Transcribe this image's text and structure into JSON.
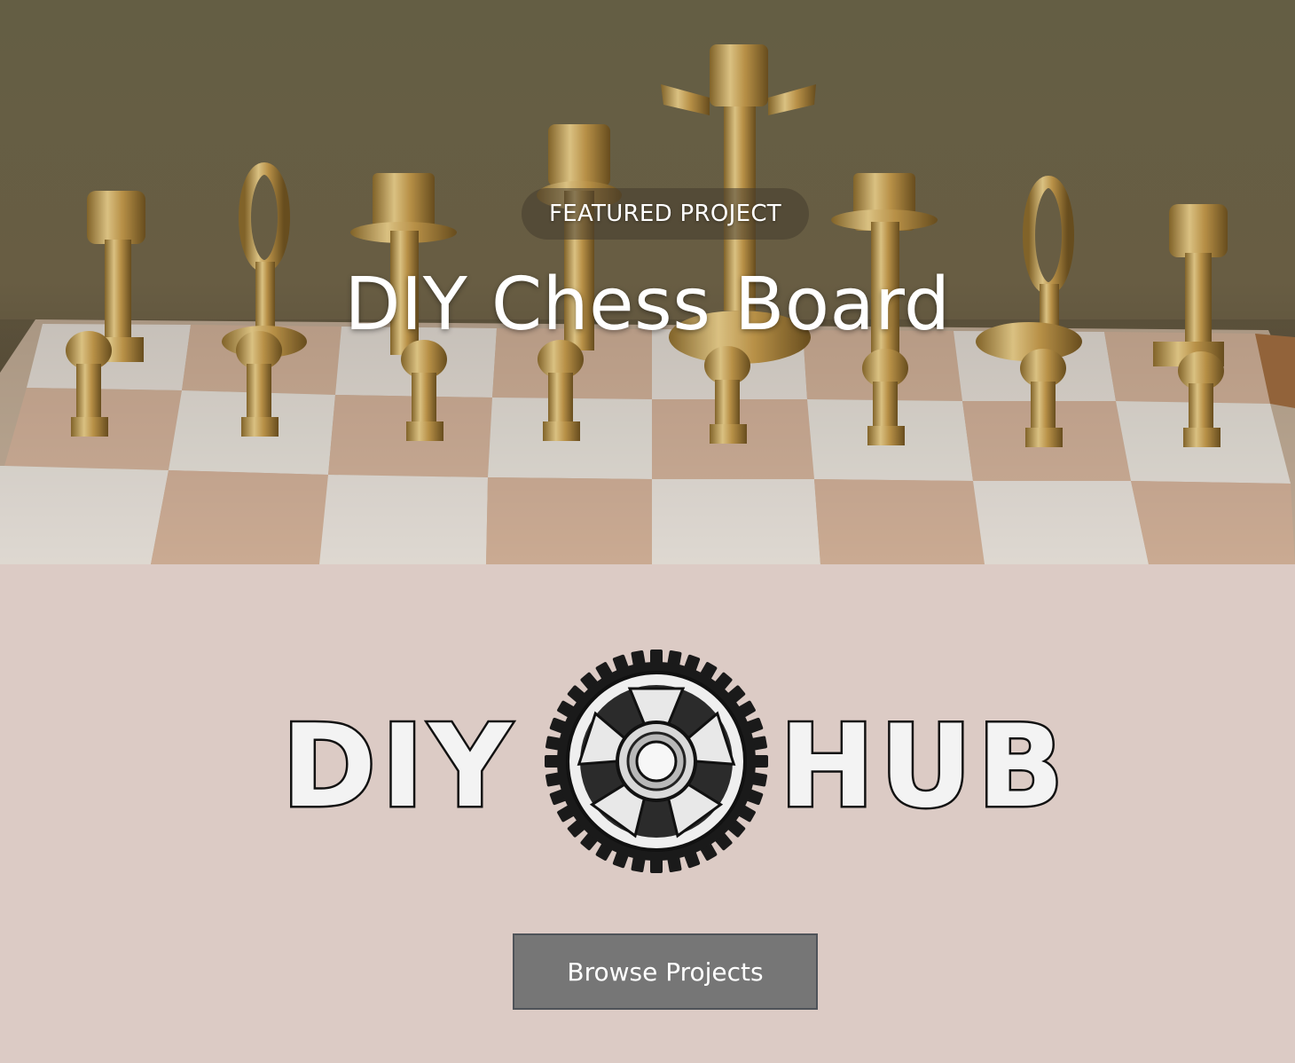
{
  "hero": {
    "featured_label": "FEATURED PROJECT",
    "title": "DIY Chess Board"
  },
  "brand": {
    "word_left": "DIY",
    "word_right": "HUB"
  },
  "actions": {
    "browse_label": "Browse Projects"
  },
  "colors": {
    "page_background": "#dccbc5",
    "button_background": "#767676",
    "button_border": "#4f5359",
    "logo_fill": "#f3f3f3",
    "logo_outline": "#111111",
    "brass": "#c9a35a"
  }
}
